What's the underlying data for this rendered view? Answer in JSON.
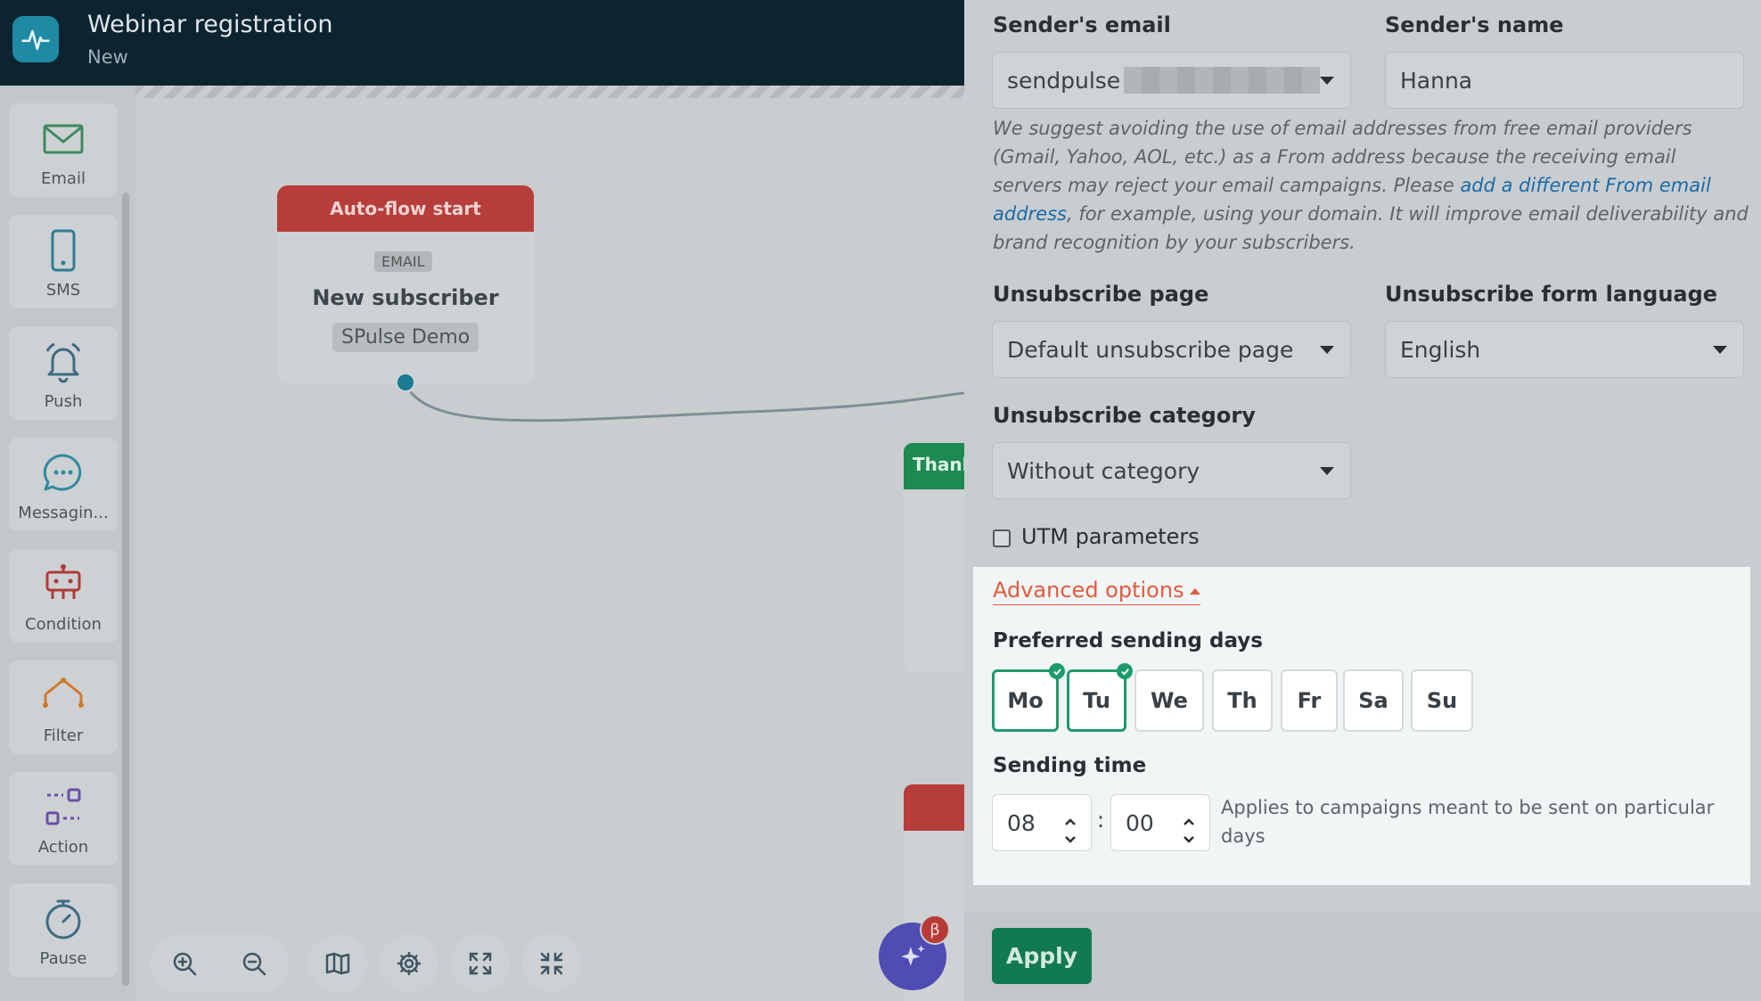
{
  "header": {
    "title": "Webinar registration",
    "subtitle": "New"
  },
  "sidebar": {
    "items": [
      {
        "label": "Email",
        "icon": "envelope-icon"
      },
      {
        "label": "SMS",
        "icon": "phone-icon"
      },
      {
        "label": "Push",
        "icon": "bell-icon"
      },
      {
        "label": "Messagin...",
        "icon": "chat-icon"
      },
      {
        "label": "Condition",
        "icon": "condition-icon"
      },
      {
        "label": "Filter",
        "icon": "filter-icon"
      },
      {
        "label": "Action",
        "icon": "action-icon"
      },
      {
        "label": "Pause",
        "icon": "timer-icon"
      }
    ]
  },
  "canvas": {
    "start_node": {
      "header": "Auto-flow start",
      "type_chip": "EMAIL",
      "title": "New subscriber",
      "list_chip": "SPulse Demo"
    },
    "thanks_node": {
      "header": "Thanl"
    },
    "beta_badge": "β"
  },
  "panel": {
    "sender_email_label": "Sender's email",
    "sender_email_value": "sendpulse",
    "sender_name_label": "Sender's name",
    "sender_name_value": "Hanna",
    "note_part1": "We suggest avoiding the use of email addresses from free email providers (Gmail, Yahoo, AOL, etc.) as a From address because the receiving email servers may reject your email campaigns. Please ",
    "note_link": "add a different From email address",
    "note_part2": ", for example, using your domain. It will improve email deliverability and brand recognition by your subscribers.",
    "unsub_page_label": "Unsubscribe page",
    "unsub_page_value": "Default unsubscribe page",
    "unsub_lang_label": "Unsubscribe form language",
    "unsub_lang_value": "English",
    "unsub_cat_label": "Unsubscribe category",
    "unsub_cat_value": "Without category",
    "utm_label": "UTM parameters",
    "advanced": {
      "toggle_label": "Advanced options",
      "days_label": "Preferred sending days",
      "days": [
        {
          "label": "Mo",
          "selected": true
        },
        {
          "label": "Tu",
          "selected": true
        },
        {
          "label": "We",
          "selected": false
        },
        {
          "label": "Th",
          "selected": false
        },
        {
          "label": "Fr",
          "selected": false
        },
        {
          "label": "Sa",
          "selected": false
        },
        {
          "label": "Su",
          "selected": false
        }
      ],
      "time_label": "Sending time",
      "hour": "08",
      "minute": "00",
      "separator": ":",
      "time_note": "Applies to campaigns meant to be sent on particular days"
    },
    "apply_label": "Apply"
  }
}
